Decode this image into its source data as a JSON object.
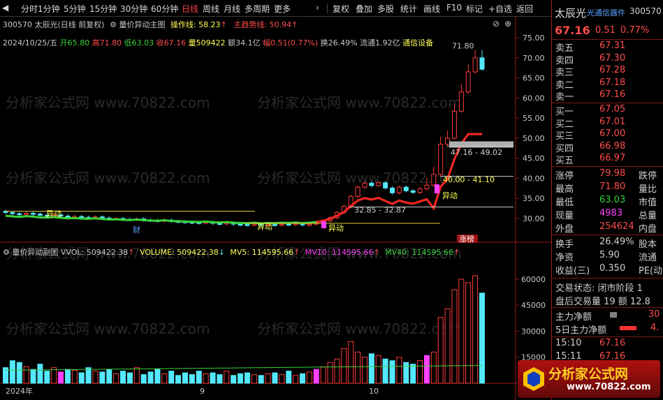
{
  "toolbar": {
    "periods": [
      "分时",
      "1分钟",
      "5分钟",
      "15分钟",
      "30分钟",
      "60分钟",
      "日线",
      "周线",
      "月线",
      "多周期",
      "更多"
    ],
    "active_period": "日线",
    "more_arrow": "›",
    "actions": [
      "复权",
      "叠加",
      "多股",
      "统计",
      "画线",
      "F10",
      "标记",
      "+自选",
      "返回"
    ]
  },
  "header": {
    "title": "300570 太辰光(日线 前复权)",
    "indicator_name": "量价异动主图",
    "op_label": "操作线: 58.23",
    "trend_label": "主趋势线: 50.94",
    "bar_info": {
      "date": "2024/10/25/五",
      "open": "开65.80",
      "high": "高71.80",
      "low": "低63.03",
      "close": "收67.16",
      "volume": "量509422",
      "amount": "额34.1亿",
      "amp": "幅0.51(0.77%)",
      "turnover": "换26.49%",
      "float": "流通1.92亿",
      "sector": "通信设备"
    }
  },
  "price_axis": [
    "75.00",
    "70.00",
    "65.00",
    "60.00",
    "55.00",
    "50.00",
    "45.00",
    "40.00",
    "35.00",
    "30.00"
  ],
  "vol_axis": [
    "60000",
    "45000",
    "30000",
    "15000"
  ],
  "dates": [
    "2024年",
    "9",
    "10"
  ],
  "annotations": {
    "high_mark": "71.80",
    "box1": "47.16 - 49.02",
    "box2": "40.00 - 41.10",
    "box3": "32.85 - 32.87",
    "yidong": "异动",
    "cai": "财",
    "zhangbang": "涨榜"
  },
  "volume_header": {
    "name": "量价异动副图",
    "vvol": "VVOL: 509422.38",
    "volume": "VOLUME: 509422.38",
    "mv5": "MV5: 114595.66",
    "mv10": "MV10: 114595.66",
    "mv40": "MV40: 114595.66"
  },
  "quote": {
    "code": "300570",
    "name": "太辰光",
    "industry": "光通信器件",
    "price": "67.16",
    "change": "0.51",
    "pct": "0.77%",
    "asks": [
      {
        "label": "卖五",
        "price": "67.31"
      },
      {
        "label": "卖四",
        "price": "67.30"
      },
      {
        "label": "卖三",
        "price": "67.28"
      },
      {
        "label": "卖二",
        "price": "67.18"
      },
      {
        "label": "卖一",
        "price": "67.16"
      }
    ],
    "bids": [
      {
        "label": "买一",
        "price": "67.05"
      },
      {
        "label": "买二",
        "price": "67.01"
      },
      {
        "label": "买三",
        "price": "67.00"
      },
      {
        "label": "买四",
        "price": "66.98"
      },
      {
        "label": "买五",
        "price": "66.97"
      }
    ],
    "stats": [
      {
        "k": "涨停",
        "v": "79.98",
        "c": "#ff4c4c",
        "k2": "跌停"
      },
      {
        "k": "最高",
        "v": "71.80",
        "c": "#ff4c4c",
        "k2": "量比"
      },
      {
        "k": "最低",
        "v": "63.03",
        "c": "#39d239",
        "k2": "市值"
      },
      {
        "k": "现量",
        "v": "4983",
        "c": "#ff40ff",
        "k2": "总量"
      },
      {
        "k": "外盘",
        "v": "254624",
        "c": "#ff4c4c",
        "k2": "内盘"
      }
    ],
    "stats2": [
      {
        "k": "换手",
        "v": "26.49%",
        "k2": "股本"
      },
      {
        "k": "净资",
        "v": "5.90",
        "k2": "流通"
      },
      {
        "k": "收益(三)",
        "v": "0.350",
        "k2": "PE(动"
      }
    ],
    "trade_status": "交易状态: 闭市阶段 1",
    "after_trade": "盘后交易量 19 额 12.8",
    "main_net": "主力净额",
    "main_net_val": "30",
    "main_net5": "5日主力净额",
    "main_net5_val": "4.",
    "ticks": [
      {
        "t": "15:10",
        "p": "67.16"
      },
      {
        "t": "15:11",
        "p": "67.16"
      }
    ]
  },
  "watermark": "分析家公式网 www.70822.com",
  "logo": {
    "text": "分析家公式网",
    "url": "www.70822.com"
  }
}
